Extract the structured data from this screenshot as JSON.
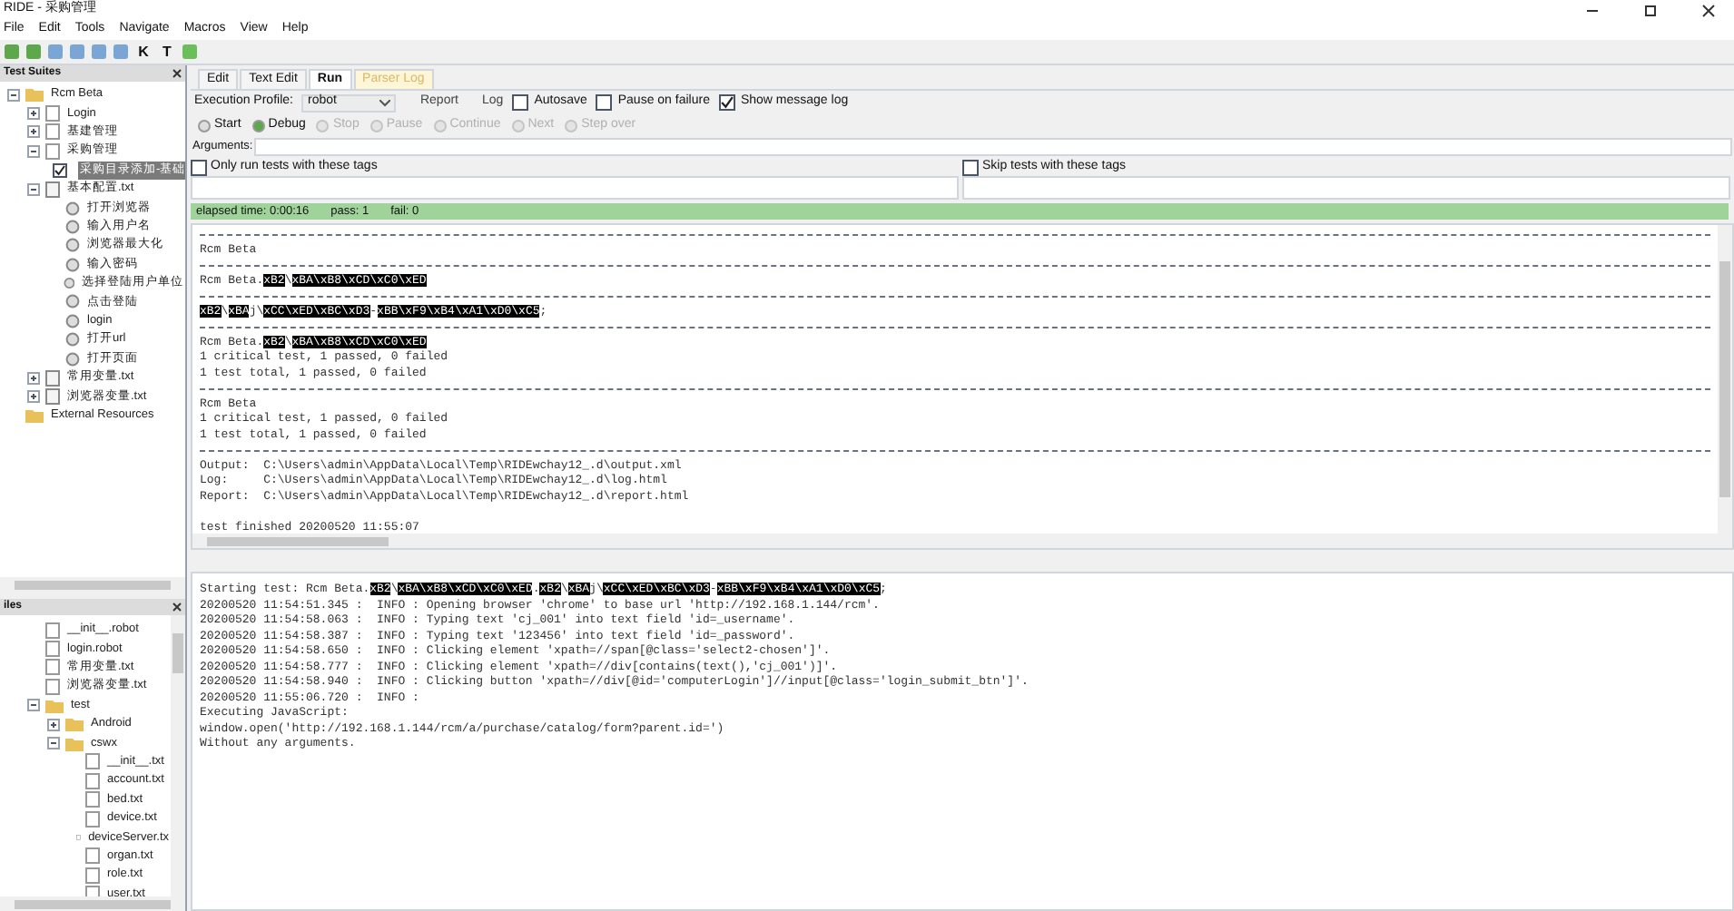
{
  "window": {
    "title": "RIDE - 采购管理"
  },
  "menu": [
    "File",
    "Edit",
    "Tools",
    "Navigate",
    "Macros",
    "View",
    "Help"
  ],
  "toolbar": [
    {
      "kind": "icon"
    },
    {
      "kind": "icon"
    },
    {
      "kind": "icon"
    },
    {
      "kind": "icon"
    },
    {
      "kind": "icon"
    },
    {
      "kind": "icon"
    },
    {
      "kind": "text",
      "label": "K"
    },
    {
      "kind": "text",
      "label": "T"
    },
    {
      "kind": "icon"
    }
  ],
  "suites_panel": {
    "title": "Test Suites",
    "tree": [
      {
        "label": "Rcm Beta",
        "kind": "folder",
        "expanded": true,
        "children": [
          {
            "label": "Login",
            "kind": "file",
            "expanded": false
          },
          {
            "label": "基建管理",
            "kind": "file",
            "expanded": false
          },
          {
            "label": "采购管理",
            "kind": "file",
            "expanded": true,
            "children": [
              {
                "label": "采购目录添加-基础",
                "kind": "test",
                "checked": true,
                "selected": true
              }
            ]
          },
          {
            "label": "基本配置.txt",
            "kind": "resource",
            "expanded": true,
            "children": [
              {
                "label": "打开浏览器",
                "kind": "keyword"
              },
              {
                "label": "输入用户名",
                "kind": "keyword"
              },
              {
                "label": "浏览器最大化",
                "kind": "keyword"
              },
              {
                "label": "输入密码",
                "kind": "keyword"
              },
              {
                "label": "选择登陆用户单位",
                "kind": "keyword"
              },
              {
                "label": "点击登陆",
                "kind": "keyword"
              },
              {
                "label": "login",
                "kind": "keyword"
              },
              {
                "label": "打开url",
                "kind": "keyword"
              },
              {
                "label": "打开页面",
                "kind": "keyword"
              }
            ]
          },
          {
            "label": "常用变量.txt",
            "kind": "resource",
            "expanded": false
          },
          {
            "label": "浏览器变量.txt",
            "kind": "resource",
            "expanded": false
          }
        ]
      },
      {
        "label": "External Resources",
        "kind": "folder"
      }
    ]
  },
  "files_panel": {
    "title": "iles",
    "tree": [
      {
        "label": "__init__.robot",
        "kind": "file"
      },
      {
        "label": "login.robot",
        "kind": "file"
      },
      {
        "label": "常用变量.txt",
        "kind": "file"
      },
      {
        "label": "浏览器变量.txt",
        "kind": "file"
      },
      {
        "label": "test",
        "kind": "folder",
        "expanded": true,
        "children": [
          {
            "label": "Android",
            "kind": "folder",
            "expanded": false
          },
          {
            "label": "cswx",
            "kind": "folder",
            "expanded": true,
            "children": [
              {
                "label": "__init__.txt",
                "kind": "file"
              },
              {
                "label": "account.txt",
                "kind": "file"
              },
              {
                "label": "bed.txt",
                "kind": "file"
              },
              {
                "label": "device.txt",
                "kind": "file"
              },
              {
                "label": "deviceServer.tx",
                "kind": "file"
              },
              {
                "label": "organ.txt",
                "kind": "file"
              },
              {
                "label": "role.txt",
                "kind": "file"
              },
              {
                "label": "user.txt",
                "kind": "file"
              }
            ]
          }
        ]
      }
    ]
  },
  "tabs": [
    {
      "label": "Edit",
      "selected": false
    },
    {
      "label": "Text Edit",
      "selected": false
    },
    {
      "label": "Run",
      "selected": true
    },
    {
      "label": "Parser Log",
      "selected": false
    }
  ],
  "run": {
    "profile_label": "Execution Profile:",
    "profile": "robot",
    "options": [
      {
        "label": "Report",
        "kind": "plain"
      },
      {
        "label": "Log",
        "kind": "plain"
      },
      {
        "label": "Autosave",
        "kind": "check",
        "checked": false
      },
      {
        "label": "Pause on failure",
        "kind": "check",
        "checked": false
      },
      {
        "label": "Show message log",
        "kind": "check",
        "checked": true
      }
    ],
    "controls": [
      {
        "label": "Start",
        "disabled": false
      },
      {
        "label": "Debug",
        "disabled": false
      },
      {
        "label": "Stop",
        "disabled": true
      },
      {
        "label": "Pause",
        "disabled": true
      },
      {
        "label": "Continue",
        "disabled": true
      },
      {
        "label": "Next",
        "disabled": true
      },
      {
        "label": "Step over",
        "disabled": true
      }
    ],
    "arguments_label": "Arguments:",
    "include_tags": {
      "label": "Only run tests with these tags",
      "checked": false
    },
    "exclude_tags": {
      "label": "Skip tests with these tags",
      "checked": false
    },
    "status": {
      "elapsed": "elapsed time: 0:00:16",
      "pass": "pass: 1",
      "fail": "fail: 0"
    }
  },
  "output": [
    [
      {
        "kind": "rule"
      }
    ],
    [
      {
        "kind": "plain",
        "text": "Rcm Beta"
      }
    ],
    [
      {
        "kind": "rule"
      }
    ],
    [
      {
        "kind": "plain",
        "text": "Rcm Beta."
      },
      {
        "kind": "hex",
        "text": "xB2"
      },
      {
        "kind": "plain",
        "text": "\\"
      },
      {
        "kind": "hex",
        "text": "xBA\\xB8\\xCD\\xC0\\xED"
      }
    ],
    [
      {
        "kind": "rule"
      }
    ],
    [
      {
        "kind": "hex",
        "text": "xB2"
      },
      {
        "kind": "plain",
        "text": "\\"
      },
      {
        "kind": "hex",
        "text": "xBA"
      },
      {
        "kind": "plain",
        "text": "j\\"
      },
      {
        "kind": "hex",
        "text": "xCC\\xED\\xBC\\xD3"
      },
      {
        "kind": "plain",
        "text": "-"
      },
      {
        "kind": "hex",
        "text": "xBB\\xF9\\xB4\\xA1\\xD0\\xC5"
      },
      {
        "kind": "plain",
        "text": ";"
      }
    ],
    [
      {
        "kind": "rule"
      }
    ],
    [
      {
        "kind": "plain",
        "text": "Rcm Beta."
      },
      {
        "kind": "hex",
        "text": "xB2"
      },
      {
        "kind": "plain",
        "text": "\\"
      },
      {
        "kind": "hex",
        "text": "xBA\\xB8\\xCD\\xC0\\xED"
      }
    ],
    [
      {
        "kind": "plain",
        "text": "1 critical test, 1 passed, 0 failed"
      }
    ],
    [
      {
        "kind": "plain",
        "text": "1 test total, 1 passed, 0 failed"
      }
    ],
    [
      {
        "kind": "rule"
      }
    ],
    [
      {
        "kind": "plain",
        "text": "Rcm Beta"
      }
    ],
    [
      {
        "kind": "plain",
        "text": "1 critical test, 1 passed, 0 failed"
      }
    ],
    [
      {
        "kind": "plain",
        "text": "1 test total, 1 passed, 0 failed"
      }
    ],
    [
      {
        "kind": "rule"
      }
    ],
    [
      {
        "kind": "plain",
        "text": "Output:  C:\\Users\\admin\\AppData\\Local\\Temp\\RIDEwchay12_.d\\output.xml"
      }
    ],
    [
      {
        "kind": "plain",
        "text": "Log:     C:\\Users\\admin\\AppData\\Local\\Temp\\RIDEwchay12_.d\\log.html"
      }
    ],
    [
      {
        "kind": "plain",
        "text": "Report:  C:\\Users\\admin\\AppData\\Local\\Temp\\RIDEwchay12_.d\\report.html"
      }
    ],
    [
      {
        "kind": "blank"
      }
    ],
    [
      {
        "kind": "plain",
        "text": "test finished 20200520 11:55:07"
      }
    ]
  ],
  "message_log": [
    [
      {
        "kind": "plain",
        "text": "Starting test: Rcm Beta."
      },
      {
        "kind": "hex",
        "text": "xB2"
      },
      {
        "kind": "plain",
        "text": "\\"
      },
      {
        "kind": "hex",
        "text": "xBA\\xB8\\xCD\\xC0\\xED"
      },
      {
        "kind": "plain",
        "text": "."
      },
      {
        "kind": "hex",
        "text": "xB2"
      },
      {
        "kind": "plain",
        "text": "\\"
      },
      {
        "kind": "hex",
        "text": "xBA"
      },
      {
        "kind": "plain",
        "text": "j\\"
      },
      {
        "kind": "hex",
        "text": "xCC\\xED\\xBC\\xD3"
      },
      {
        "kind": "plain",
        "text": "-"
      },
      {
        "kind": "hex",
        "text": "xBB\\xF9\\xB4\\xA1\\xD0\\xC5"
      },
      {
        "kind": "plain",
        "text": ";"
      }
    ],
    [
      {
        "kind": "plain",
        "text": "20200520 11:54:51.345 :  INFO : Opening browser 'chrome' to base url 'http://192.168.1.144/rcm'."
      }
    ],
    [
      {
        "kind": "plain",
        "text": "20200520 11:54:58.063 :  INFO : Typing text 'cj_001' into text field 'id=_username'."
      }
    ],
    [
      {
        "kind": "plain",
        "text": "20200520 11:54:58.387 :  INFO : Typing text '123456' into text field 'id=_password'."
      }
    ],
    [
      {
        "kind": "plain",
        "text": "20200520 11:54:58.650 :  INFO : Clicking element 'xpath=//span[@class='select2-chosen']'."
      }
    ],
    [
      {
        "kind": "plain",
        "text": "20200520 11:54:58.777 :  INFO : Clicking element 'xpath=//div[contains(text(),'cj_001')]'."
      }
    ],
    [
      {
        "kind": "plain",
        "text": "20200520 11:54:58.940 :  INFO : Clicking button 'xpath=//div[@id='computerLogin']//input[@class='login_submit_btn']'."
      }
    ],
    [
      {
        "kind": "plain",
        "text": "20200520 11:55:06.720 :  INFO :"
      }
    ],
    [
      {
        "kind": "plain",
        "text": "Executing JavaScript:"
      }
    ],
    [
      {
        "kind": "plain",
        "text": "window.open('http://192.168.1.144/rcm/a/purchase/catalog/form?parent.id=')"
      }
    ],
    [
      {
        "kind": "plain",
        "text": "Without any arguments."
      }
    ]
  ]
}
